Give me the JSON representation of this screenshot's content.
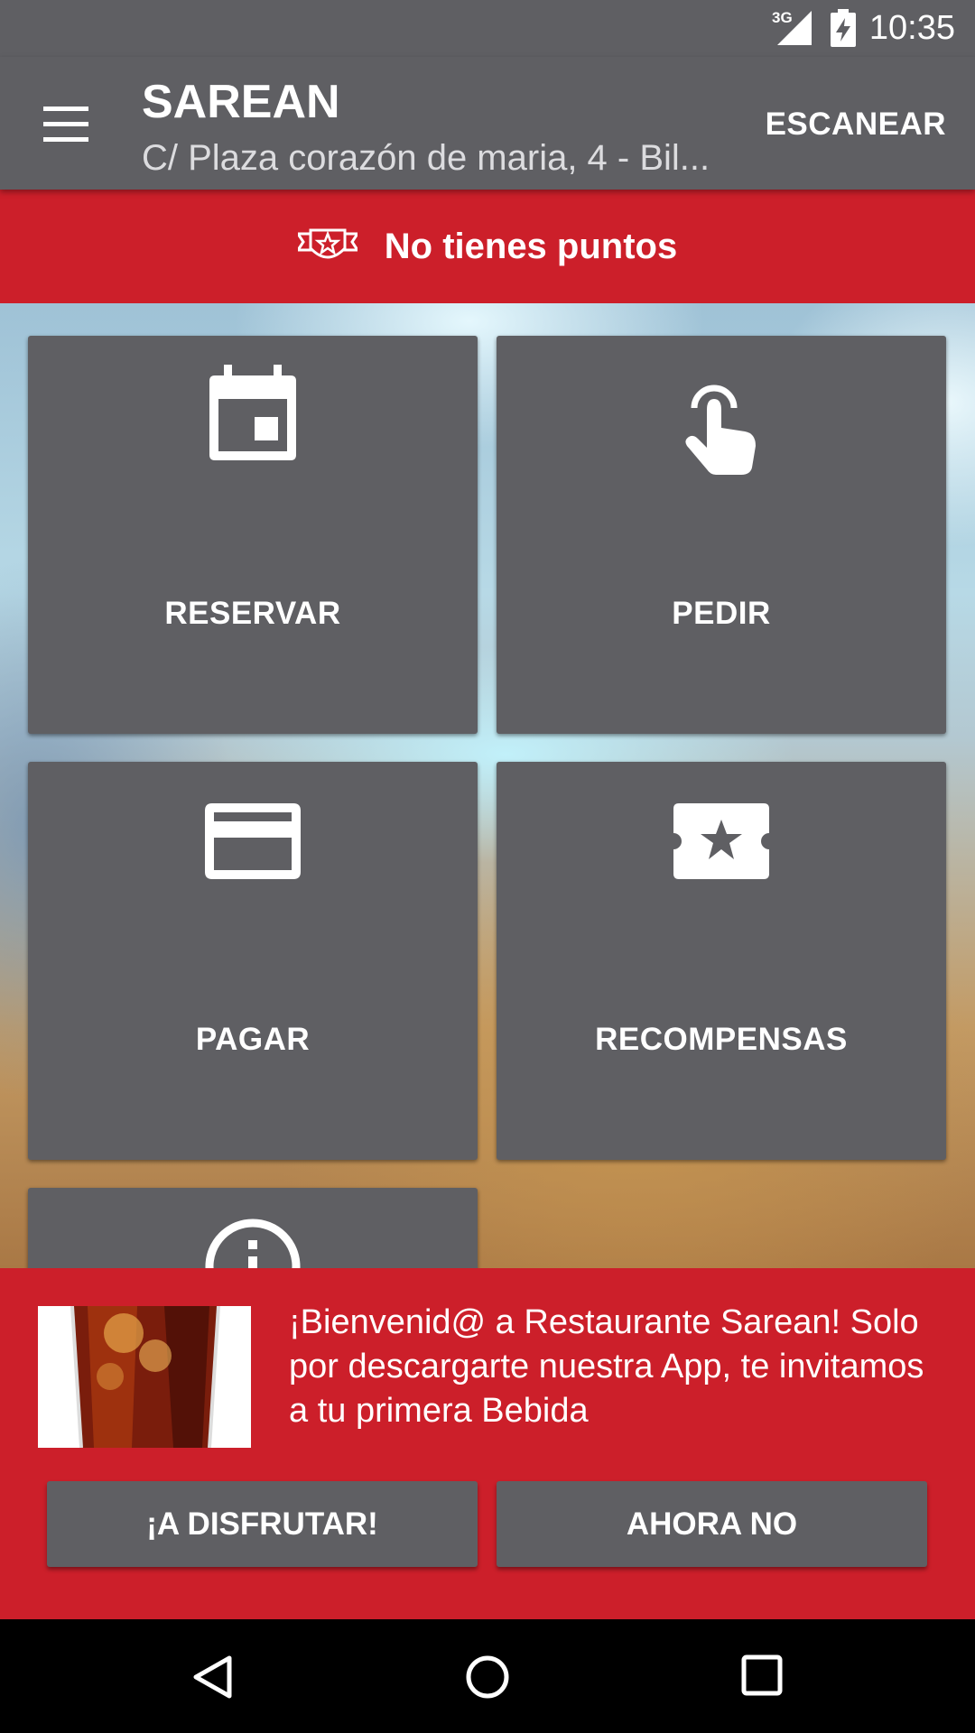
{
  "status_bar": {
    "network": "3G",
    "time": "10:35"
  },
  "app_bar": {
    "title": "SAREAN",
    "subtitle": "C/ Plaza corazón de maria, 4 - Bil...",
    "scan_label": "ESCANEAR"
  },
  "points_banner": {
    "text": "No tienes puntos"
  },
  "tiles": [
    {
      "label": "RESERVAR",
      "icon": "calendar-icon"
    },
    {
      "label": "PEDIR",
      "icon": "touch-icon"
    },
    {
      "label": "PAGAR",
      "icon": "credit-card-icon"
    },
    {
      "label": "RECOMPENSAS",
      "icon": "ticket-star-icon"
    },
    {
      "label": "",
      "icon": "info-icon"
    }
  ],
  "promo": {
    "message": "¡Bienvenid@ a Restaurante Sarean! Solo por descargarte nuestra App, te invitamos a tu primera Bebida",
    "accept_label": "¡A DISFRUTAR!",
    "decline_label": "AHORA NO"
  },
  "nav_bar": {
    "icons": [
      "back-icon",
      "home-icon",
      "recents-icon"
    ]
  },
  "colors": {
    "primary_gray": "#5f5f63",
    "accent_red": "#cc1f2a"
  }
}
